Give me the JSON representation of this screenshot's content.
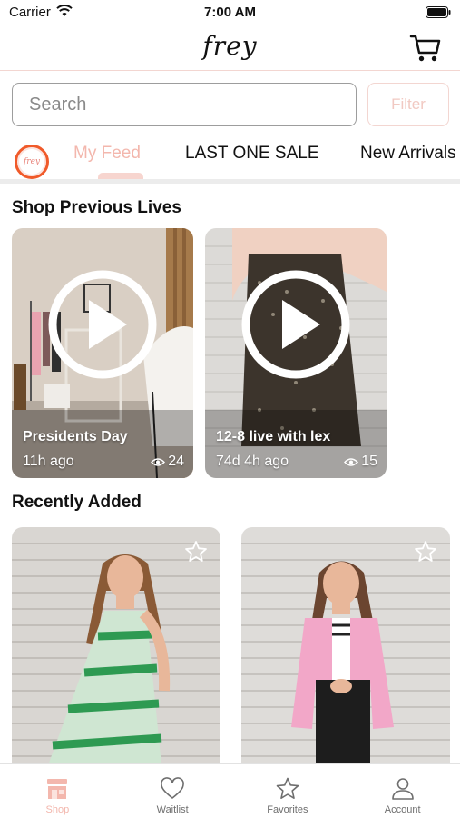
{
  "status_bar": {
    "carrier": "Carrier",
    "time": "7:00 AM"
  },
  "header": {
    "logo_text": "frey"
  },
  "search": {
    "placeholder": "Search",
    "value": ""
  },
  "filter": {
    "label": "Filter"
  },
  "avatar": {
    "text": "frey"
  },
  "tabs": [
    {
      "label": "My Feed",
      "active": true
    },
    {
      "label": "LAST ONE SALE",
      "active": false
    },
    {
      "label": "New Arrivals",
      "active": false
    }
  ],
  "sections": {
    "lives_title": "Shop Previous Lives",
    "recent_title": "Recently Added"
  },
  "lives": [
    {
      "title": "Presidents Day",
      "ago": "11h ago",
      "views": "24"
    },
    {
      "title": "12-8 live with lex",
      "ago": "74d 4h ago",
      "views": "15"
    }
  ],
  "bottom_nav": [
    {
      "label": "Shop",
      "icon": "shop-icon",
      "active": true
    },
    {
      "label": "Waitlist",
      "icon": "heart-icon",
      "active": false
    },
    {
      "label": "Favorites",
      "icon": "star-icon",
      "active": false
    },
    {
      "label": "Account",
      "icon": "person-icon",
      "active": false
    }
  ],
  "colors": {
    "accent": "#f3b7ad",
    "border_pink": "#f3d6d1",
    "avatar_ring": "#f05a2a"
  }
}
